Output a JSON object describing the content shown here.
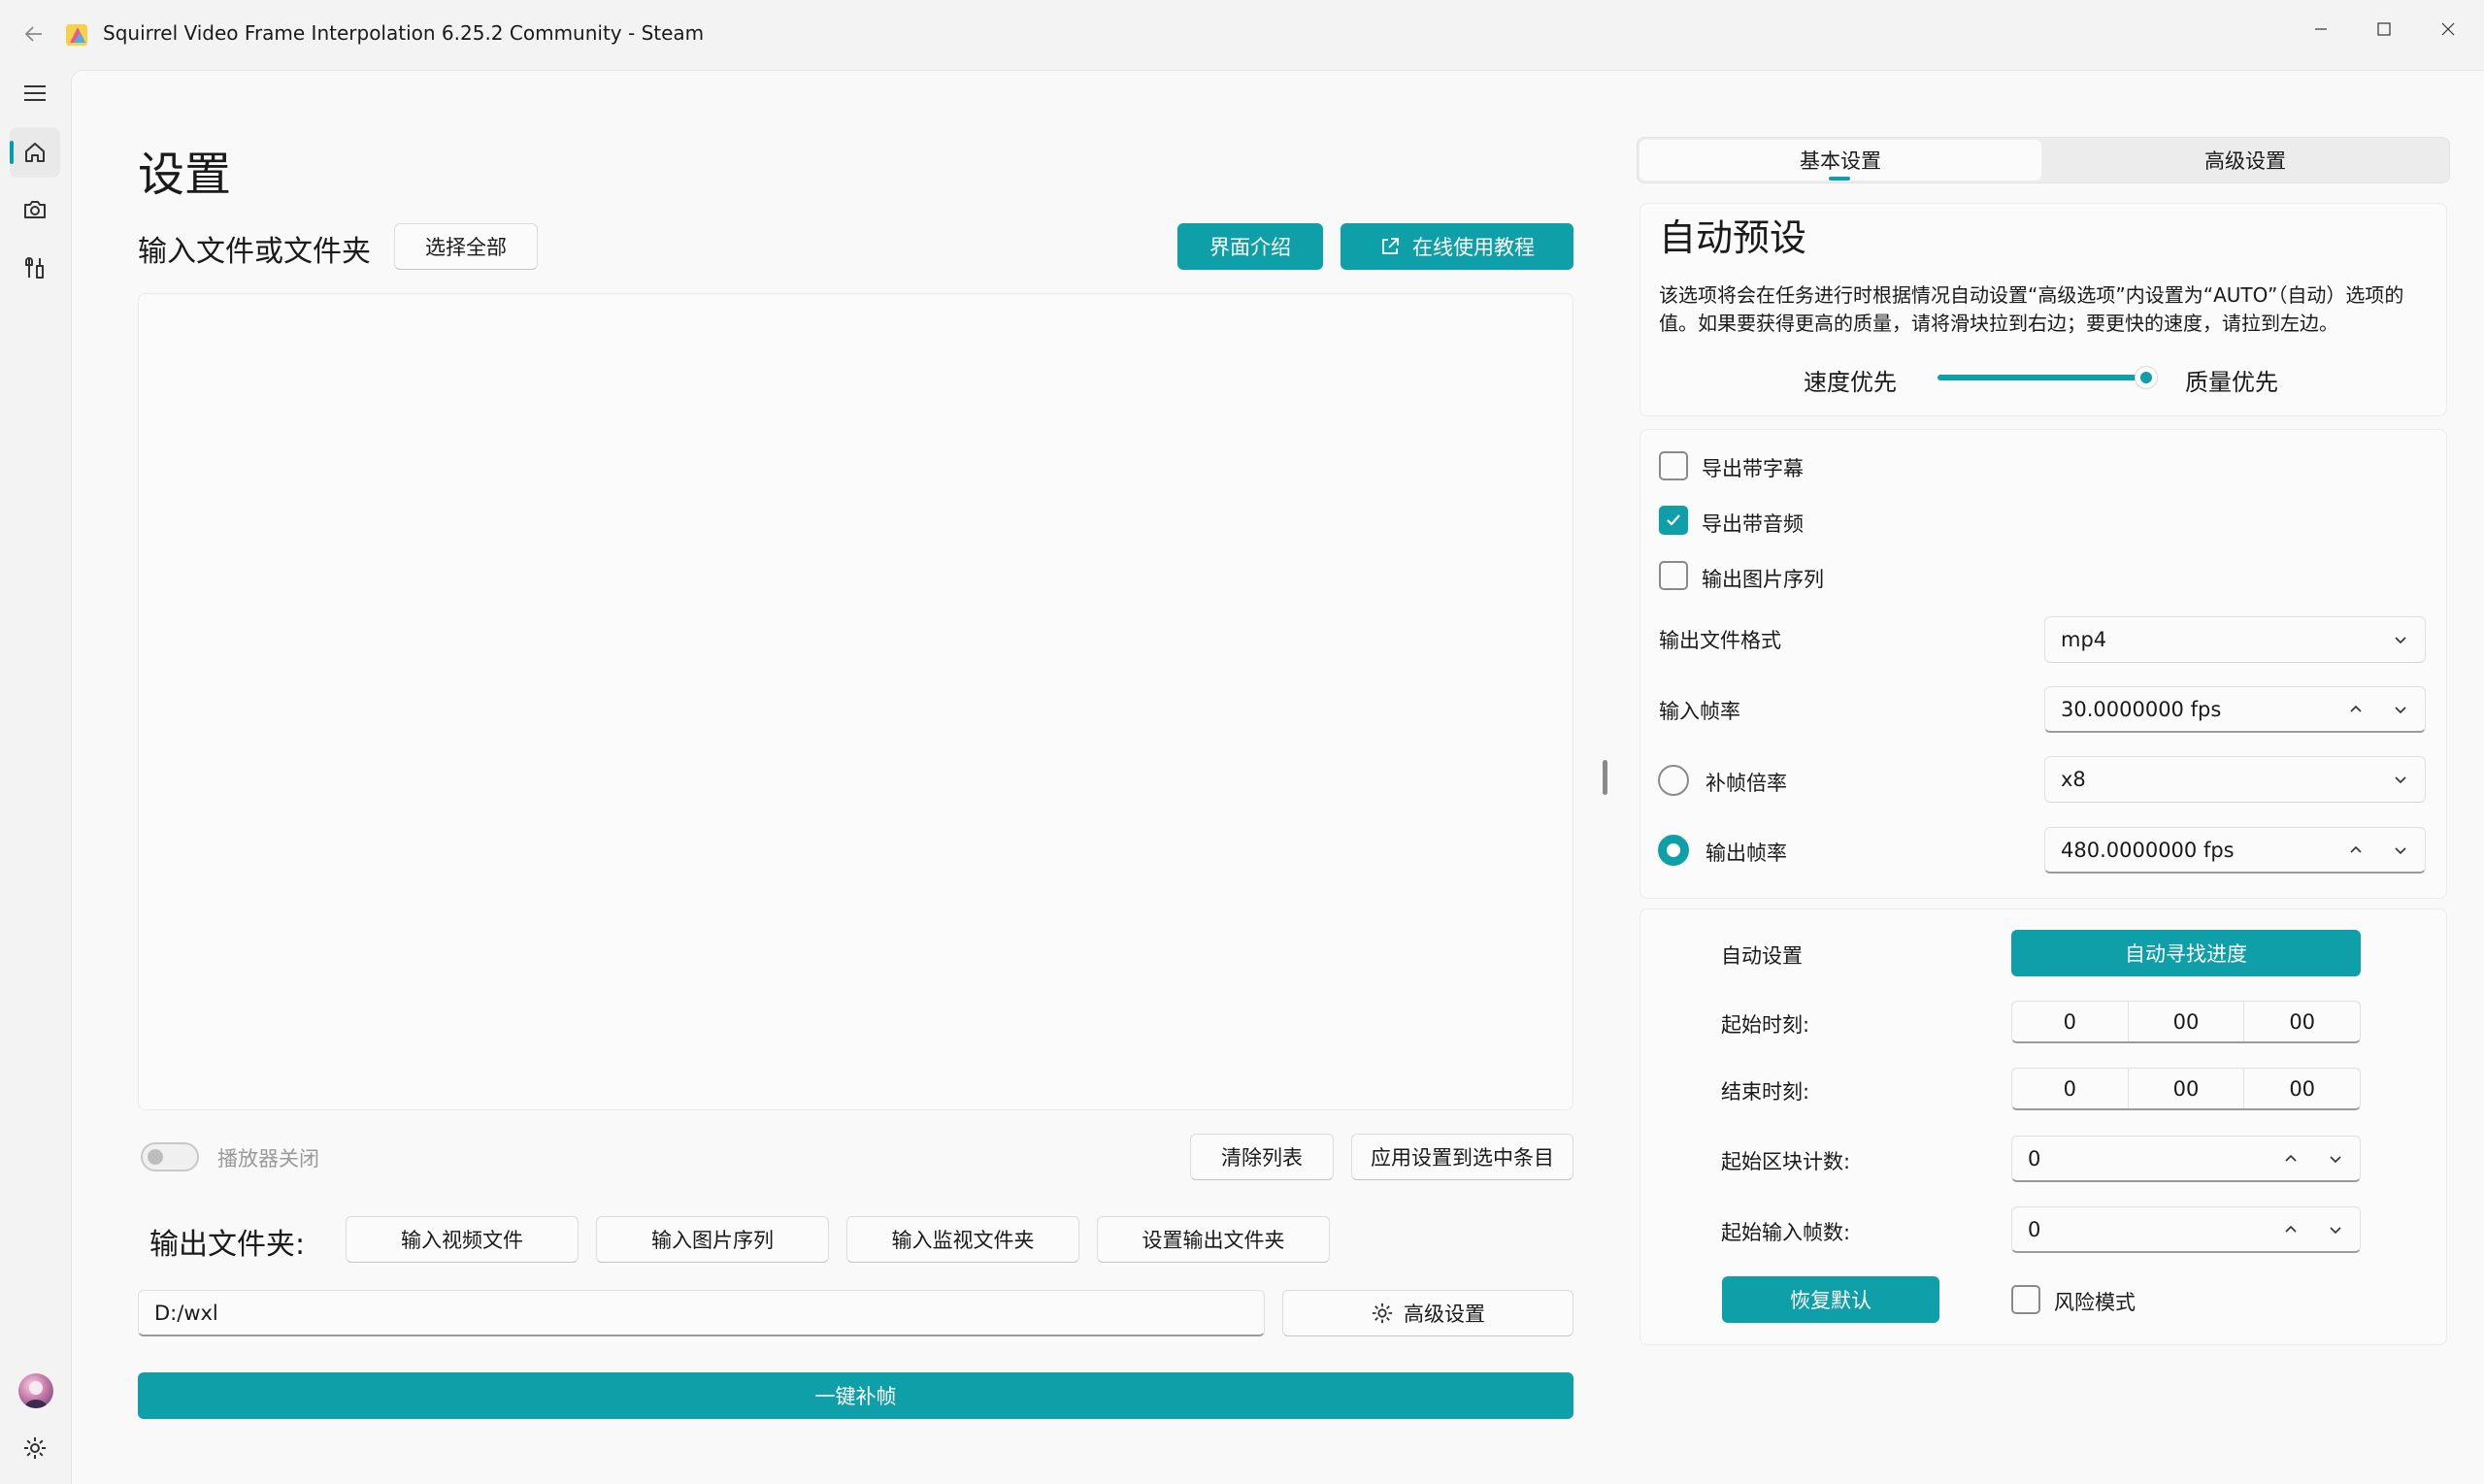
{
  "window": {
    "title": "Squirrel Video Frame Interpolation 6.25.2 Community - Steam"
  },
  "nav": {
    "items": [
      {
        "icon": "menu-icon"
      },
      {
        "icon": "home-icon",
        "active": true
      },
      {
        "icon": "camera-icon"
      },
      {
        "icon": "tools-icon"
      }
    ],
    "bottom": [
      {
        "icon": "avatar"
      },
      {
        "icon": "gear-icon"
      }
    ]
  },
  "page": {
    "title": "设置",
    "input_section_title": "输入文件或文件夹",
    "select_all_label": "选择全部",
    "ui_intro_label": "界面介绍",
    "online_tutorial_label": "在线使用教程",
    "player_toggle_label": "播放器关闭",
    "player_toggle_on": false,
    "clear_list_label": "清除列表",
    "apply_selected_label": "应用设置到选中条目",
    "output_folder_label": "输出文件夹:",
    "input_video_label": "输入视频文件",
    "input_image_seq_label": "输入图片序列",
    "input_watch_folder_label": "输入监视文件夹",
    "set_output_folder_label": "设置输出文件夹",
    "output_path_value": "D:/wxl",
    "advanced_settings_label": "高级设置",
    "one_click_label": "一键补帧"
  },
  "settings": {
    "tabs": [
      {
        "label": "基本设置",
        "active": true
      },
      {
        "label": "高级设置",
        "active": false
      }
    ],
    "auto_preset": {
      "title": "自动预设",
      "description": "该选项将会在任务进行时根据情况自动设置“高级选项”内设置为“AUTO”（自动）选项的值。如果要获得更高的质量，请将滑块拉到右边；要更快的速度，请拉到左边。",
      "slider_left_label": "速度优先",
      "slider_right_label": "质量优先",
      "slider_value": 1.0
    },
    "checkboxes": [
      {
        "label": "导出带字幕",
        "checked": false
      },
      {
        "label": "导出带音频",
        "checked": true
      },
      {
        "label": "输出图片序列",
        "checked": false
      }
    ],
    "output_format_label": "输出文件格式",
    "output_format_value": "mp4",
    "input_fps_label": "输入帧率",
    "input_fps_value": "30.0000000 fps",
    "interp_ratio_label": "补帧倍率",
    "interp_ratio_selected": false,
    "interp_ratio_value": "x8",
    "output_fps_label": "输出帧率",
    "output_fps_selected": true,
    "output_fps_value": "480.0000000 fps",
    "auto_settings_label": "自动设置",
    "auto_find_progress_label": "自动寻找进度",
    "start_time_label": "起始时刻:",
    "start_time": [
      "0",
      "00",
      "00"
    ],
    "end_time_label": "结束时刻:",
    "end_time": [
      "0",
      "00",
      "00"
    ],
    "start_chunk_label": "起始区块计数:",
    "start_chunk_value": "0",
    "start_input_frames_label": "起始输入帧数:",
    "start_input_frames_value": "0",
    "restore_default_label": "恢复默认",
    "risk_mode_label": "风险模式",
    "risk_mode_checked": false
  },
  "colors": {
    "accent": "#0f9fa8",
    "background": "#f3f3f3",
    "panel": "#f9f9f9"
  }
}
